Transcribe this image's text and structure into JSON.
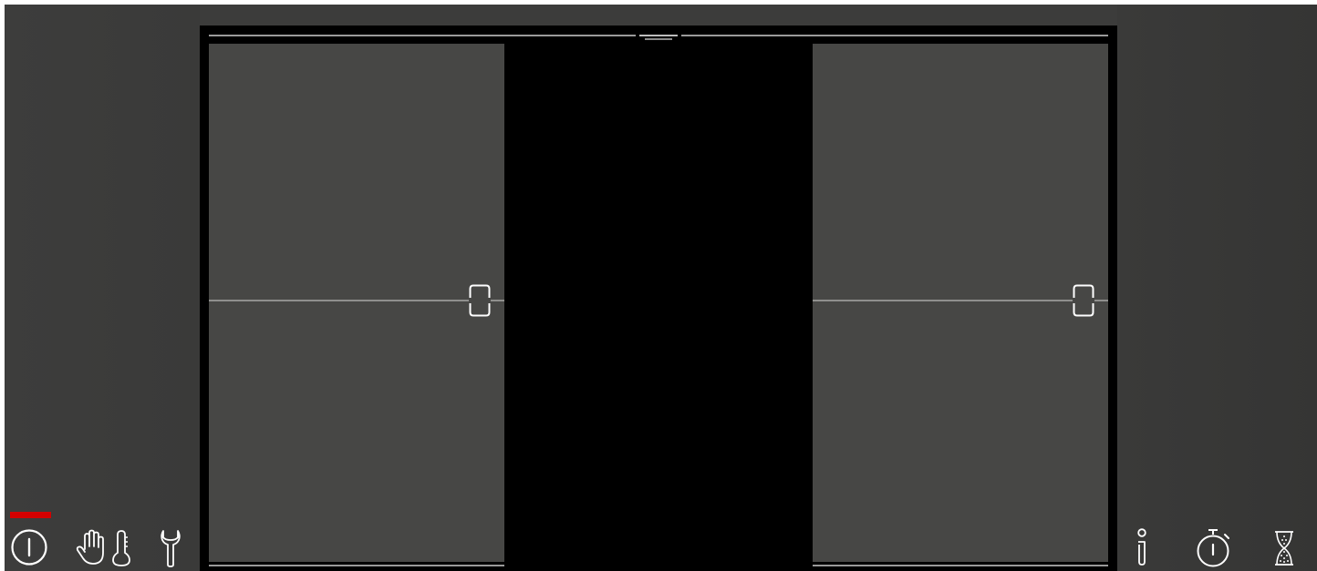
{
  "app": {
    "screen": "door-control",
    "background_color": "#3c3c3b",
    "panel_color": "#000000",
    "door_color": "#474745",
    "accent_color": "#d40000"
  },
  "left_toolbar": {
    "items": [
      {
        "icon": "power-icon",
        "active": true
      },
      {
        "icon": "hand-icon",
        "active": false
      },
      {
        "icon": "thermometer-icon",
        "active": false
      },
      {
        "icon": "wrench-icon",
        "active": false
      }
    ]
  },
  "right_toolbar": {
    "items": [
      {
        "icon": "info-icon",
        "active": false
      },
      {
        "icon": "stopwatch-icon",
        "active": false
      },
      {
        "icon": "hourglass-icon",
        "active": false
      }
    ]
  },
  "doors": {
    "state": "open",
    "left": {
      "handle_icon": "door-handle-icon"
    },
    "right": {
      "handle_icon": "door-handle-icon"
    }
  }
}
